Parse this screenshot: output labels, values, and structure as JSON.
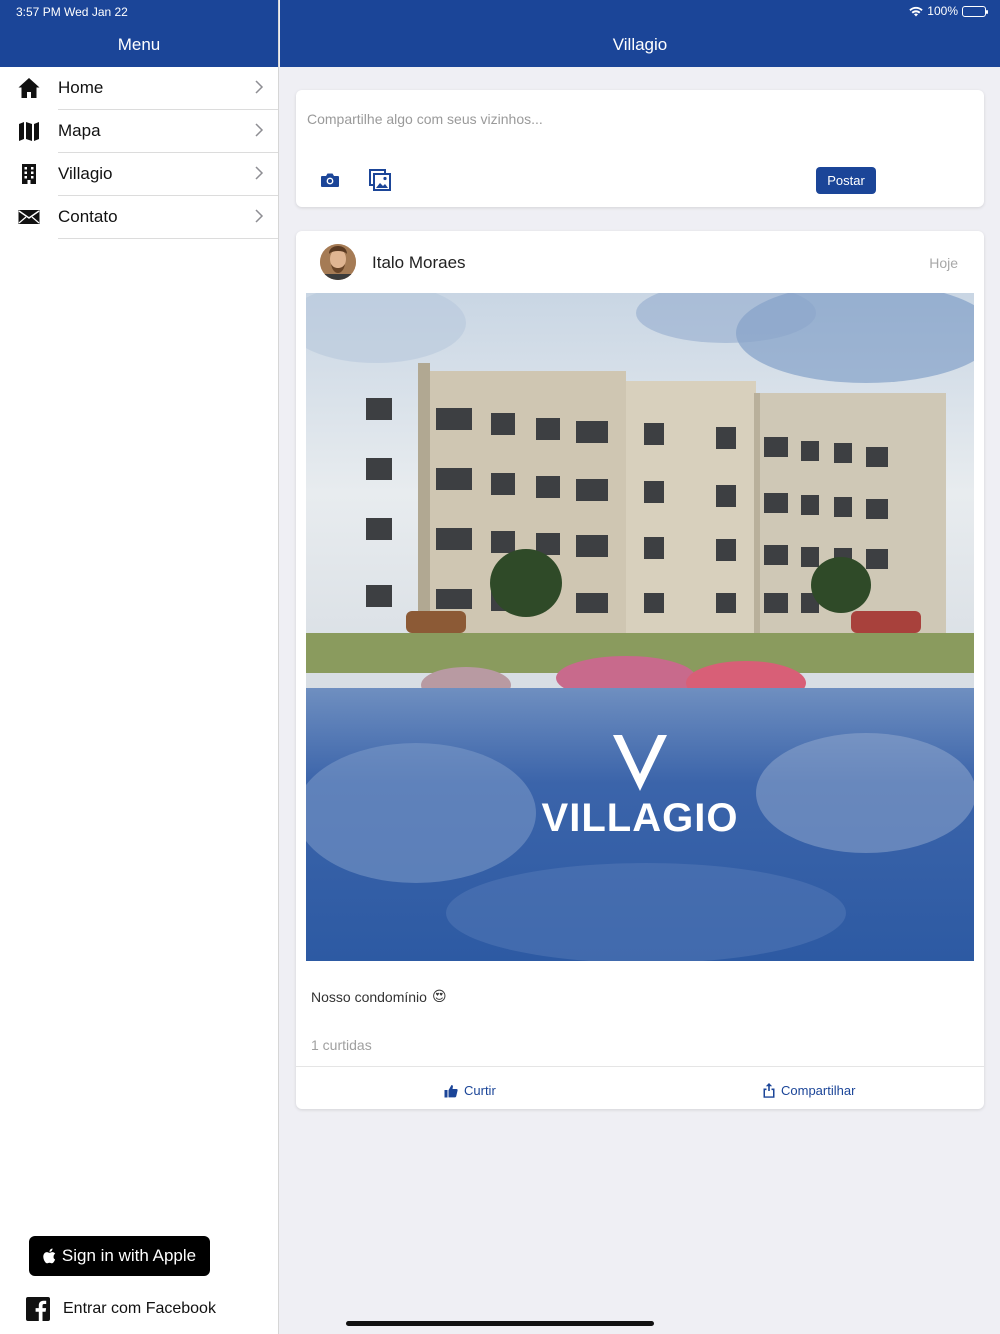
{
  "status_bar": {
    "time": "3:57 PM   Wed Jan 22",
    "battery": "100%"
  },
  "sidebar": {
    "title": "Menu",
    "items": [
      {
        "label": "Home",
        "icon": "home-icon"
      },
      {
        "label": "Mapa",
        "icon": "map-icon"
      },
      {
        "label": "Villagio",
        "icon": "building-icon"
      },
      {
        "label": "Contato",
        "icon": "envelope-icon"
      }
    ],
    "apple_button": "Sign in with Apple",
    "facebook_button": "Entrar com Facebook"
  },
  "main": {
    "title": "Villagio",
    "composer": {
      "placeholder": "Compartilhe algo com seus vizinhos...",
      "post_button": "Postar"
    },
    "post": {
      "author": "Italo Moraes",
      "date": "Hoje",
      "image_brand_text": "VILLAGIO",
      "caption": "Nosso condomínio",
      "caption_emoji": "😍",
      "likes": "1 curtidas",
      "like_label": "Curtir",
      "share_label": "Compartilhar"
    }
  },
  "colors": {
    "brand": "#1b4598",
    "background": "#efeff4"
  }
}
